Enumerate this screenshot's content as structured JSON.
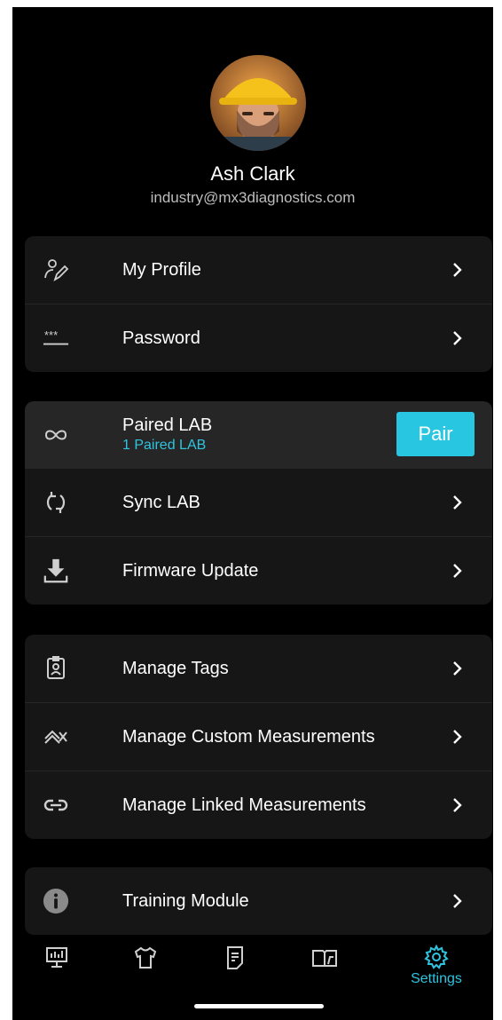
{
  "profile": {
    "name": "Ash Clark",
    "email": "industry@mx3diagnostics.com",
    "avatar_icon": "user-photo"
  },
  "account_section": [
    {
      "label": "My Profile",
      "icon": "profile-edit-icon"
    },
    {
      "label": "Password",
      "icon": "password-icon"
    }
  ],
  "paired_lab": {
    "label": "Paired LAB",
    "subtitle": "1 Paired LAB",
    "button": "Pair",
    "icon": "infinity-link-icon"
  },
  "lab_section": [
    {
      "label": "Sync LAB",
      "icon": "sync-icon"
    },
    {
      "label": "Firmware Update",
      "icon": "download-icon"
    }
  ],
  "manage_section": [
    {
      "label": "Manage Tags",
      "icon": "id-badge-icon"
    },
    {
      "label": "Manage Custom Measurements",
      "icon": "double-chevron-icon"
    },
    {
      "label": "Manage Linked Measurements",
      "icon": "link-icon"
    }
  ],
  "training_section": [
    {
      "label": "Training Module",
      "icon": "info-icon"
    }
  ],
  "tabbar": {
    "tabs": [
      "dashboard-icon",
      "shirt-icon",
      "document-icon",
      "book-icon",
      "settings-icon"
    ],
    "active_label": "Settings"
  },
  "colors": {
    "accent": "#29c6e1",
    "background": "#000000",
    "card": "#161616",
    "paired_row": "#262626"
  }
}
